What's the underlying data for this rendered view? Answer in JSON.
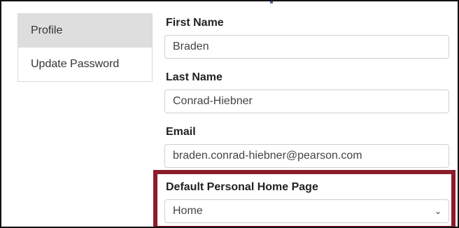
{
  "sidebar": {
    "items": [
      {
        "label": "Profile",
        "active": true
      },
      {
        "label": "Update Password",
        "active": false
      }
    ]
  },
  "form": {
    "first_name": {
      "label": "First Name",
      "value": "Braden"
    },
    "last_name": {
      "label": "Last Name",
      "value": "Conrad-Hiebner"
    },
    "email": {
      "label": "Email",
      "value": "braden.conrad-hiebner@pearson.com"
    },
    "home_page": {
      "label": "Default Personal Home Page",
      "selected": "Home"
    }
  },
  "colors": {
    "highlight": "#8c1c2b",
    "active_item_bg": "#dedede"
  },
  "icons": {
    "select_chevron": "chevron-down-icon"
  }
}
